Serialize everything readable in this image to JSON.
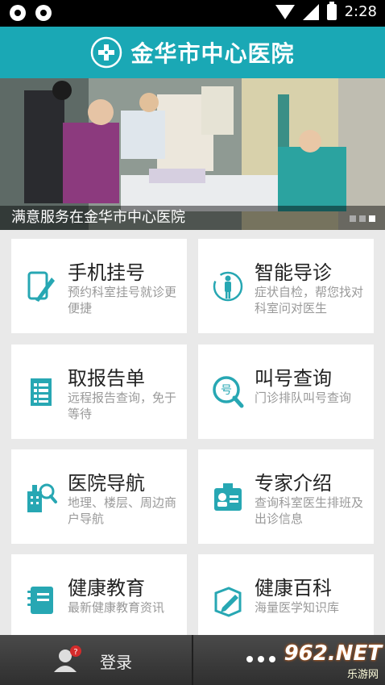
{
  "status_bar": {
    "time": "2:28"
  },
  "header": {
    "title": "金华市中心医院"
  },
  "banner": {
    "caption": "满意服务在金华市中心医院",
    "slides": 3,
    "active_slide": 3
  },
  "menu": [
    {
      "title": "手机挂号",
      "desc": "预约科室挂号就诊更便捷",
      "icon": "phone-register-icon"
    },
    {
      "title": "智能导诊",
      "desc": "症状自检，帮您找对科室问对医生",
      "icon": "body-guide-icon"
    },
    {
      "title": "取报告单",
      "desc": "远程报告查询，免于等待",
      "icon": "report-sheet-icon"
    },
    {
      "title": "叫号查询",
      "desc": "门诊排队叫号查询",
      "icon": "number-search-icon"
    },
    {
      "title": "医院导航",
      "desc": "地理、楼层、周边商户导航",
      "icon": "hospital-map-icon"
    },
    {
      "title": "专家介绍",
      "desc": "查询科室医生排班及出诊信息",
      "icon": "expert-badge-icon"
    },
    {
      "title": "健康教育",
      "desc": "最新健康教育资讯",
      "icon": "notebook-icon"
    },
    {
      "title": "健康百科",
      "desc": "海量医学知识库",
      "icon": "encyclopedia-edit-icon"
    }
  ],
  "bottom_bar": {
    "login_label": "登录",
    "badge": "?",
    "watermark": "962.NET",
    "watermark_sub": "乐游网"
  },
  "colors": {
    "accent": "#1aa8b5",
    "icon": "#27a7b3"
  }
}
